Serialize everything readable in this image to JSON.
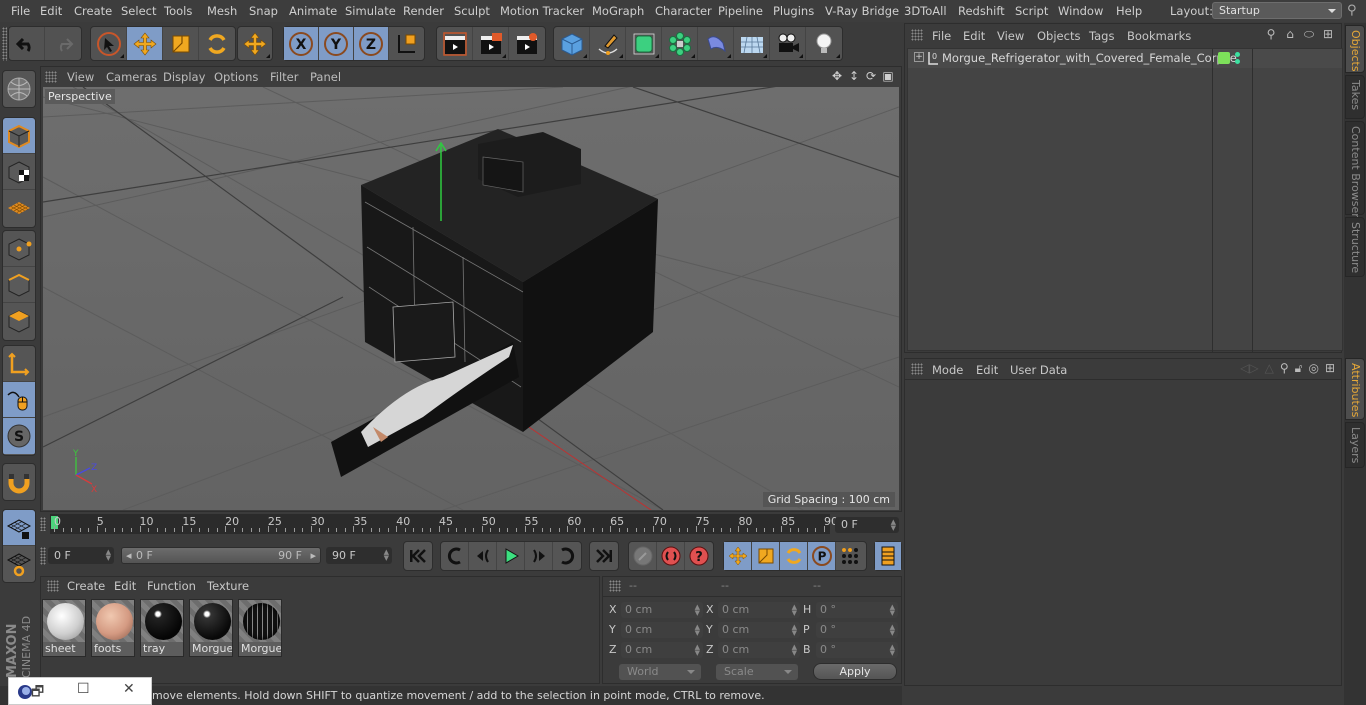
{
  "app": {
    "name": "Cinema 4D",
    "brand": "MAXON CINEMA 4D"
  },
  "menubar": {
    "items": [
      "File",
      "Edit",
      "Create",
      "Select",
      "Tools",
      "Mesh",
      "Snap",
      "Animate",
      "Simulate",
      "Render",
      "Sculpt",
      "Motion Tracker",
      "MoGraph",
      "Character",
      "Pipeline",
      "Plugins",
      "V-Ray Bridge",
      "3DToAll",
      "Redshift",
      "Script",
      "Window",
      "Help"
    ],
    "layout_label": "Layout:",
    "layout_value": "Startup"
  },
  "toolbar": {
    "groups": [
      {
        "name": "history",
        "tools": [
          "undo-icon",
          "redo-icon"
        ]
      },
      {
        "name": "transform",
        "tools": [
          "live-selection-icon",
          "move-icon",
          "scale-icon",
          "rotate-icon"
        ]
      },
      {
        "name": "recent",
        "tools": [
          "move-icon"
        ]
      },
      {
        "name": "axis",
        "tools": [
          "x-axis-lock-icon",
          "y-axis-lock-icon",
          "z-axis-lock-icon",
          "coordinate-system-icon"
        ]
      },
      {
        "name": "render",
        "tools": [
          "render-view-icon",
          "render-picture-viewer-icon",
          "render-settings-icon"
        ]
      },
      {
        "name": "create",
        "tools": [
          "cube-icon",
          "pen-spline-icon",
          "subdivision-icon",
          "cloner-icon",
          "deformer-icon",
          "floor-icon",
          "camera-icon",
          "light-icon"
        ]
      }
    ]
  },
  "left_tools": [
    "make-editable-icon",
    "model-mode-icon",
    "texture-mode-icon",
    "workplane-icon",
    "points-mode-icon",
    "edges-mode-icon",
    "polygons-mode-icon",
    "axis-mode-icon",
    "tweak-mode-icon",
    "solo-icon",
    "snap-magnet-icon",
    "lock-workplane-icon",
    "workplane-align-icon"
  ],
  "viewport": {
    "menu": [
      "View",
      "Cameras",
      "Display",
      "Options",
      "Filter",
      "Panel"
    ],
    "camera_label": "Perspective",
    "grid_spacing": "Grid Spacing : 100 cm",
    "axis_labels": {
      "x": "X",
      "y": "Y",
      "z": "Z"
    },
    "colors": {
      "x": "#d83c3c",
      "y": "#3cc83c",
      "z": "#4a4ae0"
    }
  },
  "timeline": {
    "ticks": [
      "0",
      "5",
      "10",
      "15",
      "20",
      "25",
      "30",
      "35",
      "40",
      "45",
      "50",
      "55",
      "60",
      "65",
      "70",
      "75",
      "80",
      "85",
      "90"
    ],
    "current_frame_right": "0 F",
    "current_frame": "0 F",
    "range_start": "0 F",
    "range_end": "90 F",
    "end_frame": "90 F",
    "playhead_frame": 0,
    "max_frame": 90
  },
  "materials": {
    "menu": [
      "Create",
      "Edit",
      "Function",
      "Texture"
    ],
    "items": [
      {
        "name": "sheet",
        "color": "#d9d9d9"
      },
      {
        "name": "foots",
        "color": "#d9a08a"
      },
      {
        "name": "tray",
        "color": "#111111"
      },
      {
        "name": "Morgue",
        "color": "#1a1a1a"
      },
      {
        "name": "Morgue",
        "color": "#2a2a2a"
      }
    ]
  },
  "coordinates": {
    "headers": [
      "--",
      "--",
      "--"
    ],
    "position": [
      {
        "axis": "X",
        "value": "0 cm"
      },
      {
        "axis": "Y",
        "value": "0 cm"
      },
      {
        "axis": "Z",
        "value": "0 cm"
      }
    ],
    "size": [
      {
        "axis": "X",
        "value": "0 cm"
      },
      {
        "axis": "Y",
        "value": "0 cm"
      },
      {
        "axis": "Z",
        "value": "0 cm"
      }
    ],
    "rotation": [
      {
        "axis": "H",
        "value": "0 °"
      },
      {
        "axis": "P",
        "value": "0 °"
      },
      {
        "axis": "B",
        "value": "0 °"
      }
    ],
    "space": "World",
    "mode": "Scale",
    "apply_label": "Apply"
  },
  "object_manager": {
    "menu": [
      "File",
      "Edit",
      "View",
      "Objects",
      "Tags",
      "Bookmarks"
    ],
    "objects": [
      {
        "name": "Morgue_Refrigerator_with_Covered_Female_Corpse",
        "layer_color": "#7de05a"
      }
    ]
  },
  "attribute_manager": {
    "menu": [
      "Mode",
      "Edit",
      "User Data"
    ]
  },
  "right_tabs": {
    "top": [
      {
        "label": "Objects",
        "active": true
      },
      {
        "label": "Takes",
        "active": false
      },
      {
        "label": "Content Browser",
        "active": false
      },
      {
        "label": "Structure",
        "active": false
      }
    ],
    "bottom": [
      {
        "label": "Attributes",
        "active": true
      },
      {
        "label": "Layers",
        "active": false
      }
    ]
  },
  "status": {
    "text": "move elements. Hold down SHIFT to quantize movement / add to the selection in point mode, CTRL to remove."
  },
  "taskbar_window": {
    "restore": "🗗",
    "maximize": "☐",
    "close": "✕"
  }
}
